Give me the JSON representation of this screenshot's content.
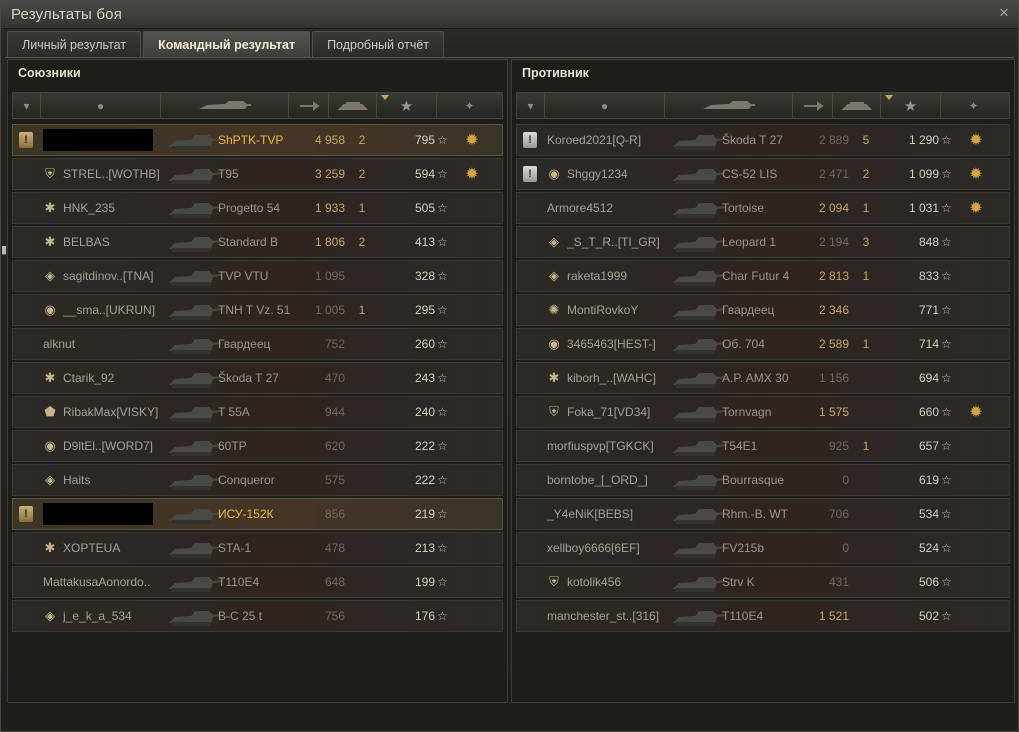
{
  "window": {
    "title": "Результаты боя",
    "close_icon": "×"
  },
  "tabs": [
    {
      "label": "Личный результат"
    },
    {
      "label": "Командный результат"
    },
    {
      "label": "Подробный отчёт"
    }
  ],
  "allies": {
    "title": "Союзники",
    "rows": [
      {
        "platoon": "!",
        "clan": "",
        "name": "",
        "vehicle": "ShPTK-TVP",
        "damage": "4 958",
        "kills": "2",
        "xp": "795",
        "medal": "✹"
      },
      {
        "platoon": "",
        "clan": "⛨",
        "name": "STREL..[WOTHB]",
        "vehicle": "T95",
        "damage": "3 259",
        "kills": "2",
        "xp": "594",
        "medal": "✹"
      },
      {
        "platoon": "",
        "clan": "✱",
        "name": "HNK_235",
        "vehicle": "Progetto 54",
        "damage": "1 933",
        "kills": "1",
        "xp": "505",
        "medal": ""
      },
      {
        "platoon": "",
        "clan": "✱",
        "name": "BELBAS",
        "vehicle": "Standard B",
        "damage": "1 806",
        "kills": "2",
        "xp": "413",
        "medal": ""
      },
      {
        "platoon": "",
        "clan": "◈",
        "name": "sagitdinov..[TNA]",
        "vehicle": "TVP VTU",
        "damage": "1 095",
        "kills": "",
        "xp": "328",
        "medal": ""
      },
      {
        "platoon": "",
        "clan": "◉",
        "name": "__sma..[UKRUN]",
        "vehicle": "TNH T Vz. 51",
        "damage": "1 005",
        "kills": "1",
        "xp": "295",
        "medal": ""
      },
      {
        "platoon": "",
        "clan": "",
        "name": "alknut",
        "vehicle": "Гвардеец",
        "damage": "752",
        "kills": "",
        "xp": "260",
        "medal": ""
      },
      {
        "platoon": "",
        "clan": "✱",
        "name": "Ctarik_92",
        "vehicle": "Škoda T 27",
        "damage": "470",
        "kills": "",
        "xp": "243",
        "medal": ""
      },
      {
        "platoon": "",
        "clan": "⬟",
        "name": "RibakMax[VISKY]",
        "vehicle": "T 55A",
        "damage": "944",
        "kills": "",
        "xp": "240",
        "medal": ""
      },
      {
        "platoon": "",
        "clan": "◉",
        "name": "D9ltEl..[WORD7]",
        "vehicle": "60TP",
        "damage": "620",
        "kills": "",
        "xp": "222",
        "medal": ""
      },
      {
        "platoon": "",
        "clan": "◈",
        "name": "Haits",
        "vehicle": "Conqueror",
        "damage": "575",
        "kills": "",
        "xp": "222",
        "medal": ""
      },
      {
        "platoon": "!",
        "clan": "",
        "name": "",
        "vehicle": "ИСУ-152К",
        "damage": "856",
        "kills": "",
        "xp": "219",
        "medal": ""
      },
      {
        "platoon": "",
        "clan": "✱",
        "name": "XOPTEUA",
        "vehicle": "STA-1",
        "damage": "478",
        "kills": "",
        "xp": "213",
        "medal": ""
      },
      {
        "platoon": "",
        "clan": "",
        "name": "MattakusaAonordo..",
        "vehicle": "T110E4",
        "damage": "648",
        "kills": "",
        "xp": "199",
        "medal": ""
      },
      {
        "platoon": "",
        "clan": "◈",
        "name": "j_e_k_a_534",
        "vehicle": "B-C 25 t",
        "damage": "756",
        "kills": "",
        "xp": "176",
        "medal": ""
      }
    ]
  },
  "enemies": {
    "title": "Противник",
    "rows": [
      {
        "platoon": "!",
        "clan": "",
        "name": "Koroed2021[Q-R]",
        "vehicle": "Škoda T 27",
        "damage": "2 889",
        "kills": "5",
        "xp": "1 290",
        "medal": "✹"
      },
      {
        "platoon": "!",
        "clan": "◉",
        "name": "Shggy1234",
        "vehicle": "CS-52 LIS",
        "damage": "2 471",
        "kills": "2",
        "xp": "1 099",
        "medal": "✹"
      },
      {
        "platoon": "",
        "clan": "",
        "name": "Armore4512",
        "vehicle": "Tortoise",
        "damage": "2 094",
        "kills": "1",
        "xp": "1 031",
        "medal": "✹"
      },
      {
        "platoon": "",
        "clan": "◈",
        "name": "_S_T_R..[TI_GR]",
        "vehicle": "Leopard 1",
        "damage": "2 194",
        "kills": "3",
        "xp": "848",
        "medal": ""
      },
      {
        "platoon": "",
        "clan": "◈",
        "name": "raketa1999",
        "vehicle": "Char Futur 4",
        "damage": "2 813",
        "kills": "1",
        "xp": "833",
        "medal": ""
      },
      {
        "platoon": "",
        "clan": "✺",
        "name": "MontiRovkoY",
        "vehicle": "Гвардеец",
        "damage": "2 346",
        "kills": "",
        "xp": "771",
        "medal": ""
      },
      {
        "platoon": "",
        "clan": "◉",
        "name": "3465463[HEST-]",
        "vehicle": "Об. 704",
        "damage": "2 589",
        "kills": "1",
        "xp": "714",
        "medal": ""
      },
      {
        "platoon": "",
        "clan": "✱",
        "name": "kiborh_..[WAHC]",
        "vehicle": "A.P. AMX 30",
        "damage": "1 156",
        "kills": "",
        "xp": "694",
        "medal": ""
      },
      {
        "platoon": "",
        "clan": "⛨",
        "name": "Foka_71[VD34]",
        "vehicle": "Tornvagn",
        "damage": "1 575",
        "kills": "",
        "xp": "660",
        "medal": "✹"
      },
      {
        "platoon": "",
        "clan": "",
        "name": "morfiuspvp[TGKCK]",
        "vehicle": "T54E1",
        "damage": "925",
        "kills": "1",
        "xp": "657",
        "medal": ""
      },
      {
        "platoon": "",
        "clan": "",
        "name": "borntobe_[_ORD_]",
        "vehicle": "Bourrasque",
        "damage": "0",
        "kills": "",
        "xp": "619",
        "medal": ""
      },
      {
        "platoon": "",
        "clan": "",
        "name": "_Y4eNiK[BEBS]",
        "vehicle": "Rhm.-B. WT",
        "damage": "706",
        "kills": "",
        "xp": "534",
        "medal": ""
      },
      {
        "platoon": "",
        "clan": "",
        "name": "xellboy6666[6EF]",
        "vehicle": "FV215b",
        "damage": "0",
        "kills": "",
        "xp": "524",
        "medal": ""
      },
      {
        "platoon": "",
        "clan": "⛨",
        "name": "kotolik456",
        "vehicle": "Strv K",
        "damage": "431",
        "kills": "",
        "xp": "506",
        "medal": ""
      },
      {
        "platoon": "",
        "clan": "",
        "name": "manchester_st..[316]",
        "vehicle": "T110E4",
        "damage": "1 521",
        "kills": "",
        "xp": "502",
        "medal": ""
      }
    ]
  },
  "columns": {
    "platoon_icon": "▾",
    "player_icon": "●",
    "xp_icon": "★",
    "medal_icon": "✦",
    "star_glyph": "☆"
  },
  "colors": {
    "accent": "#c9a864",
    "gold_vehicle": "#ecb94a",
    "text": "#c8c3b4"
  }
}
